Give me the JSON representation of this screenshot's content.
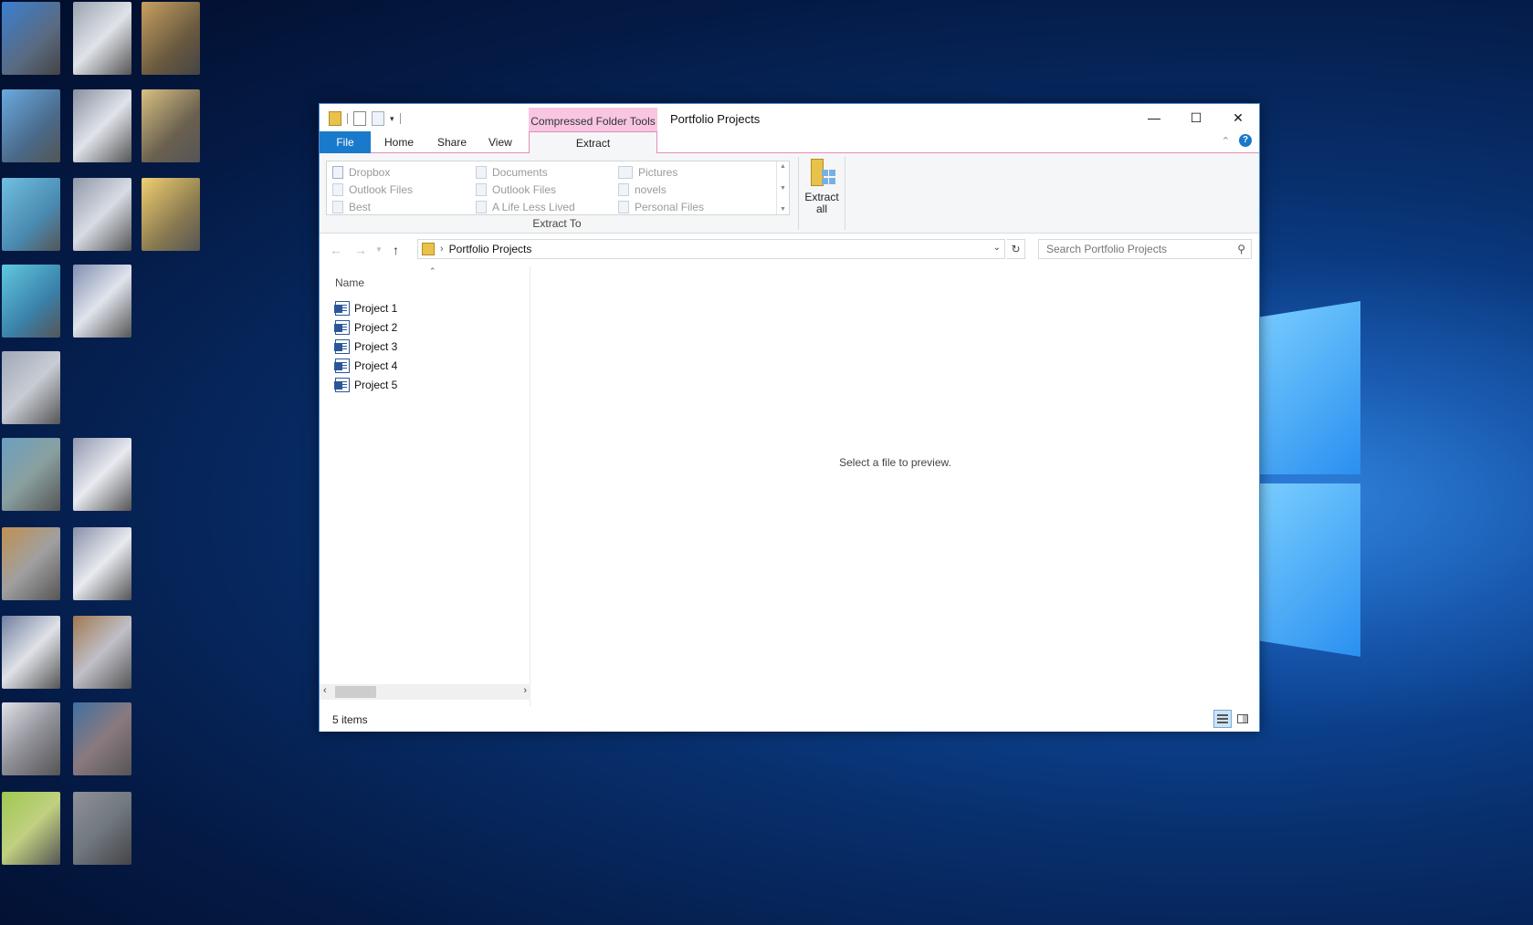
{
  "colors": {
    "accent": "#1979ca",
    "contextual_tab": "#f8c6e0",
    "desktop": "#08306e"
  },
  "window": {
    "title": "Portfolio Projects",
    "contextual_tab_header": "Compressed Folder Tools"
  },
  "tabs": {
    "file": "File",
    "home": "Home",
    "share": "Share",
    "view": "View",
    "extract": "Extract"
  },
  "ribbon": {
    "extract_to_items": [
      {
        "label": "Dropbox",
        "icon": "dropbox-icon"
      },
      {
        "label": "Outlook Files",
        "icon": "folder-icon"
      },
      {
        "label": "Best",
        "icon": "folder-icon"
      },
      {
        "label": "Documents",
        "icon": "documents-icon"
      },
      {
        "label": "Outlook Files",
        "icon": "folder-icon"
      },
      {
        "label": "A Life Less Lived",
        "icon": "folder-icon"
      },
      {
        "label": "Pictures",
        "icon": "pictures-icon"
      },
      {
        "label": "novels",
        "icon": "folder-icon"
      },
      {
        "label": "Personal Files",
        "icon": "folder-icon"
      }
    ],
    "group_label": "Extract To",
    "extract_all_line1": "Extract",
    "extract_all_line2": "all"
  },
  "address": {
    "path": "Portfolio Projects",
    "search_placeholder": "Search Portfolio Projects"
  },
  "file_list": {
    "column_header": "Name",
    "items": [
      "Project 1",
      "Project 2",
      "Project 3",
      "Project 4",
      "Project 5"
    ]
  },
  "preview": {
    "message": "Select a file to preview."
  },
  "status": {
    "item_count": "5 items"
  }
}
